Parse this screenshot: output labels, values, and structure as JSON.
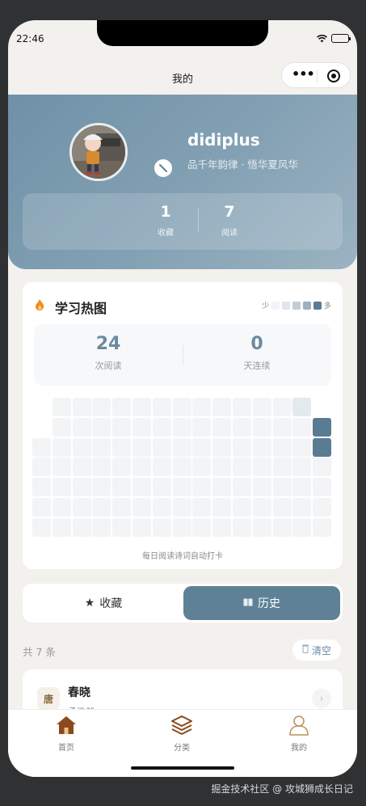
{
  "status_bar": {
    "time": "22:46"
  },
  "nav": {
    "title": "我的"
  },
  "profile": {
    "username": "didiplus",
    "motto": "品千年韵律 · 悟华夏风华",
    "stats": [
      {
        "value": "1",
        "label": "收藏"
      },
      {
        "value": "7",
        "label": "阅读"
      }
    ]
  },
  "heatmap": {
    "title": "学习热图",
    "legend_low": "少",
    "legend_high": "多",
    "legend_colors": [
      "#f2f4f6",
      "#dfe5ea",
      "#c1ced8",
      "#9bb1c0",
      "#5a7c92"
    ],
    "summary": [
      {
        "value": "24",
        "label": "次阅读"
      },
      {
        "value": "0",
        "label": "天连续"
      }
    ],
    "footer": "每日阅读诗词自动打卡"
  },
  "tabs": {
    "favorites": "收藏",
    "history": "历史",
    "active": "history"
  },
  "list": {
    "count_text": "共 7 条",
    "clear_label": "清空",
    "items": [
      {
        "dynasty": "唐",
        "title": "春晓",
        "author": "孟浩然"
      }
    ]
  },
  "tabbar": {
    "items": [
      {
        "label": "首页",
        "icon": "home-icon"
      },
      {
        "label": "分类",
        "icon": "layers-icon"
      },
      {
        "label": "我的",
        "icon": "user-icon"
      }
    ]
  },
  "colors": {
    "accent": "#5e8196",
    "brown": "#8b4a1e"
  },
  "watermark": "掘金技术社区 @ 攻城狮成长日记"
}
